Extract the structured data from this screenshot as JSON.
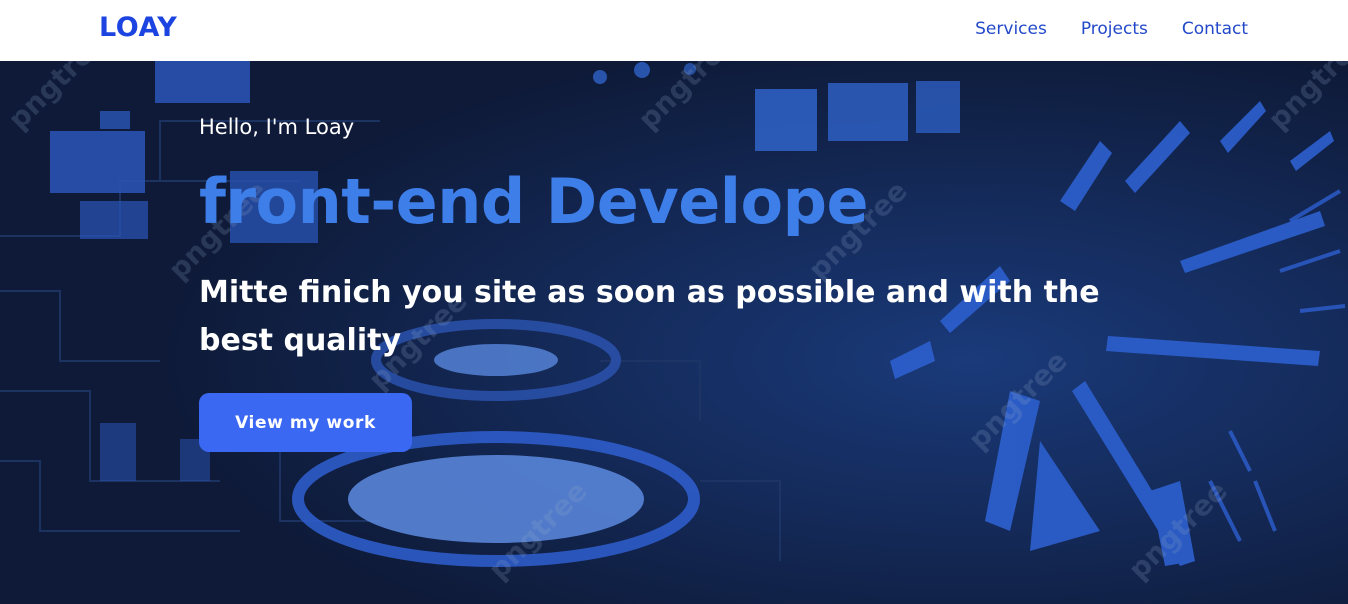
{
  "navbar": {
    "logo": "LOAY",
    "links": [
      {
        "label": "Services"
      },
      {
        "label": "Projects"
      },
      {
        "label": "Contact"
      }
    ]
  },
  "hero": {
    "greeting": "Hello, I'm Loay",
    "headline": "front-end Develope",
    "subtitle": "Mitte finich you site as soon as possible and with the best quality",
    "cta_label": "View my work",
    "watermark": "pngtree"
  },
  "colors": {
    "brand": "#1c44e0",
    "nav_link": "#2349c9",
    "headline": "#3d7ee8",
    "button": "#3b68f2",
    "hero_bg": "#0f1b3b"
  }
}
